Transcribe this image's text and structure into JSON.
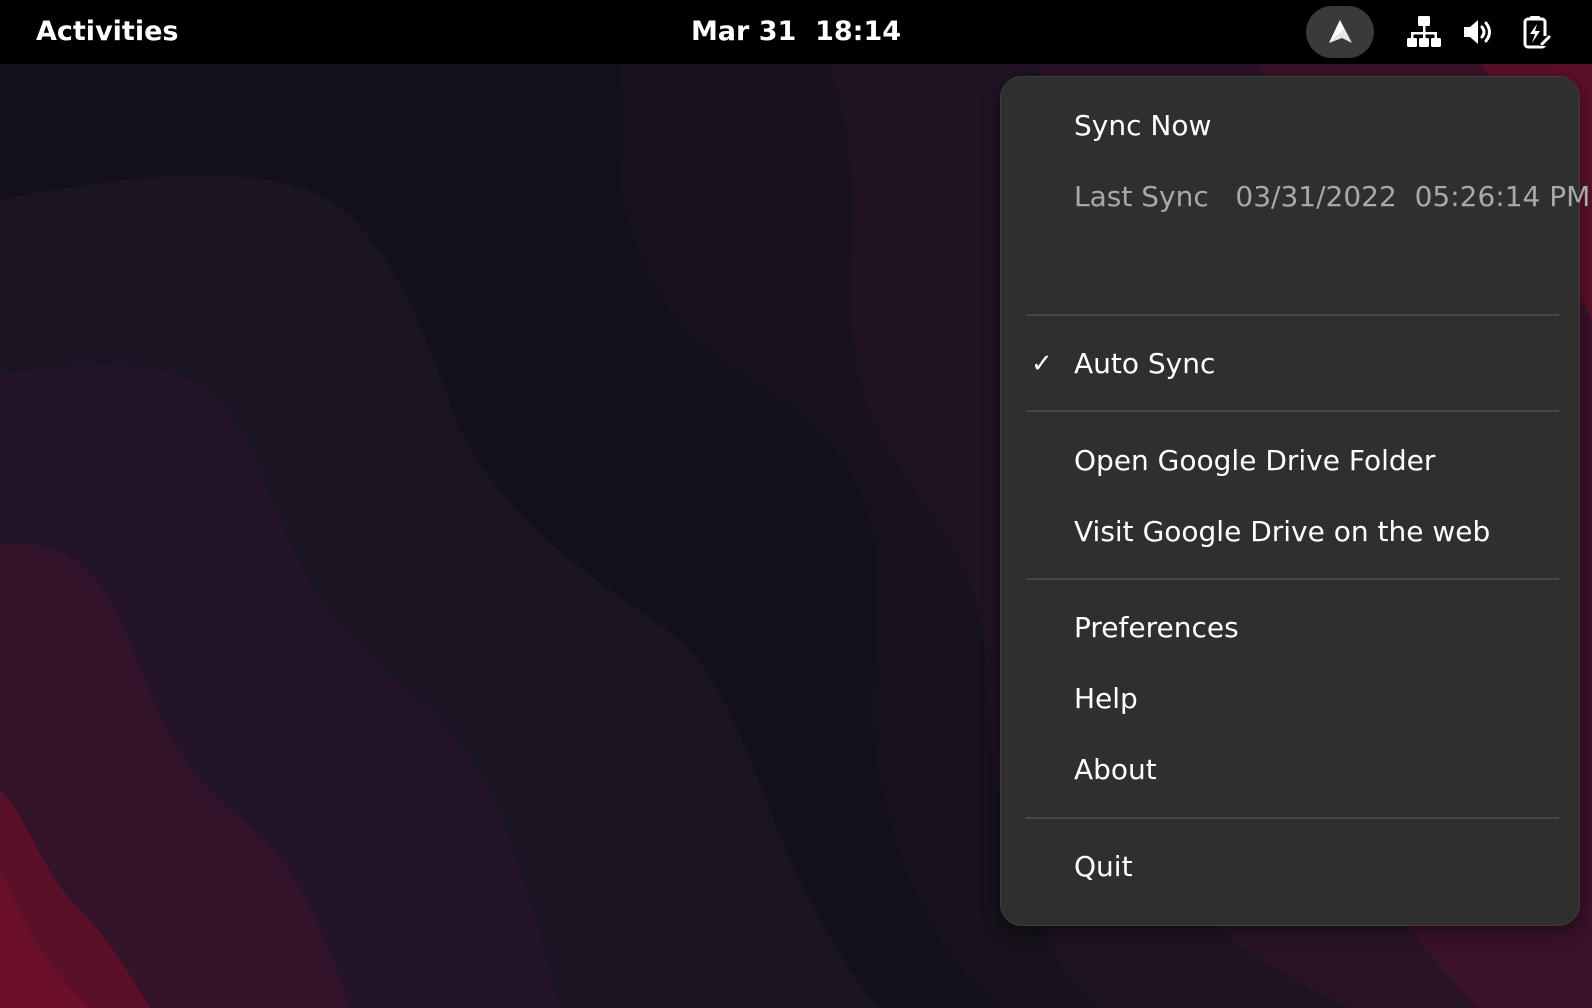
{
  "topbar": {
    "activities": "Activities",
    "clock": "Mar 31  18:14"
  },
  "tray": {
    "app_icon": "insync-icon",
    "network_icon": "network-wired-icon",
    "volume_icon": "volume-high-icon",
    "battery_icon": "battery-charging-icon"
  },
  "menu": {
    "sync_now": "Sync Now",
    "last_sync": "Last Sync   03/31/2022  05:26:14 PM",
    "auto_sync": "Auto Sync",
    "auto_sync_check": "✓",
    "open_folder": "Open Google Drive Folder",
    "visit_web": "Visit Google Drive on the web",
    "preferences": "Preferences",
    "help": "Help",
    "about": "About",
    "quit": "Quit"
  },
  "colors": {
    "topbar": "#000000",
    "menu_background": "#2f2f2f",
    "separator": "#474747",
    "disabled_text": "#a8a8a8",
    "wallpaper_dark": "#121019",
    "wallpaper_accent": "#6b1028"
  }
}
